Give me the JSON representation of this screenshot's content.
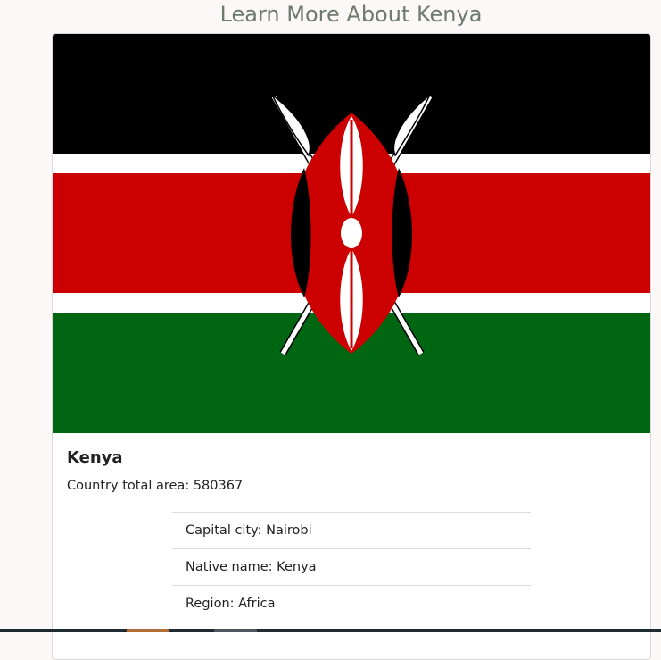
{
  "page": {
    "title": "Learn More About Kenya"
  },
  "country": {
    "name": "Kenya",
    "total_area_text": "Country total area: 580367",
    "details": [
      "Capital city: Nairobi",
      "Native name: Kenya",
      "Region: Africa"
    ]
  },
  "flag": {
    "icon": "kenya-flag",
    "colors": {
      "black": "#000000",
      "white": "#ffffff",
      "red": "#cc0000",
      "green": "#006611"
    }
  },
  "colors": {
    "title_text": "#6d7a6d",
    "page_background": "#fbf8f7"
  }
}
